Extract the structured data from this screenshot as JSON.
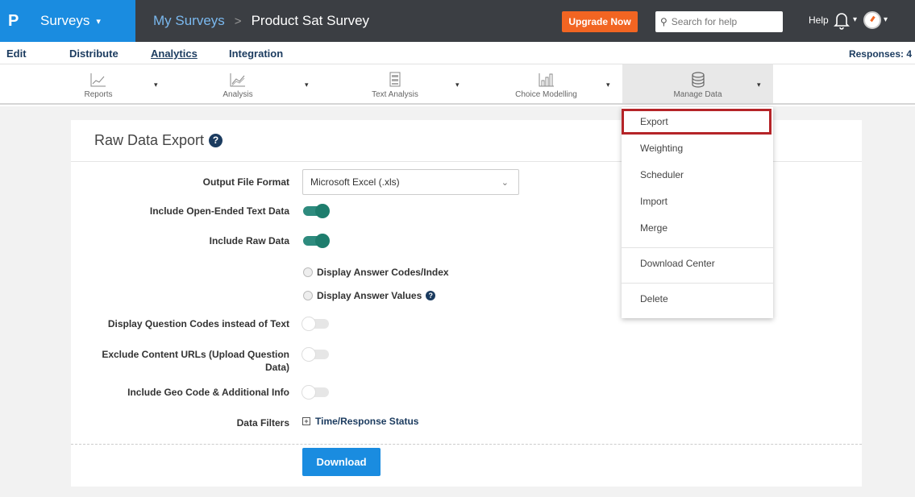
{
  "brand": {
    "logo": "P",
    "product": "Surveys",
    "caret": "▾"
  },
  "breadcrumb": {
    "parent": "My Surveys",
    "separator": ">",
    "current": "Product Sat Survey"
  },
  "header": {
    "upgrade_label": "Upgrade Now",
    "search_placeholder": "Search for help",
    "help_label": "Help",
    "caret": "▾"
  },
  "tabs": {
    "items": [
      {
        "label": "Edit"
      },
      {
        "label": "Distribute"
      },
      {
        "label": "Analytics",
        "active": true
      },
      {
        "label": "Integration"
      }
    ],
    "responses": "Responses: 4"
  },
  "toolbar": {
    "caret": "▾",
    "items": [
      {
        "label": "Reports",
        "icon": "line-chart-icon"
      },
      {
        "label": "Analysis",
        "icon": "area-chart-icon"
      },
      {
        "label": "Text Analysis",
        "icon": "text-grid-icon"
      },
      {
        "label": "Choice Modelling",
        "icon": "bar-chart-icon"
      },
      {
        "label": "Manage Data",
        "icon": "database-icon",
        "active": true
      }
    ]
  },
  "card": {
    "title": "Raw Data Export",
    "help_glyph": "?",
    "output_format_label": "Output File Format",
    "output_format_value": "Microsoft Excel (.xls)",
    "chevron": "⌄",
    "open_ended_label": "Include Open-Ended Text Data",
    "open_ended_on": true,
    "raw_data_label": "Include Raw Data",
    "raw_data_on": true,
    "radio_codes_label": "Display Answer Codes/Index",
    "radio_values_label": "Display Answer Values",
    "question_codes_label": "Display Question Codes instead of Text",
    "question_codes_on": false,
    "exclude_urls_label_1": "Exclude Content URLs (Upload Question",
    "exclude_urls_label_2": "Data)",
    "exclude_urls_on": false,
    "geo_label": "Include Geo Code & Additional Info",
    "geo_on": false,
    "filters_label": "Data Filters",
    "filters_plus": "+",
    "filters_value": "Time/Response Status",
    "download_label": "Download"
  },
  "manage_menu": {
    "items": [
      "Export",
      "Weighting",
      "Scheduler",
      "Import",
      "Merge",
      "Download Center",
      "Delete"
    ],
    "highlighted": "Export"
  },
  "colors": {
    "brand_blue": "#1a8ce0",
    "header_dark": "#3b3e43",
    "upgrade_orange": "#f26522",
    "toggle_on": "#2e8b7e",
    "highlight_red": "#b52428",
    "nav_text": "#1b3b5f"
  }
}
